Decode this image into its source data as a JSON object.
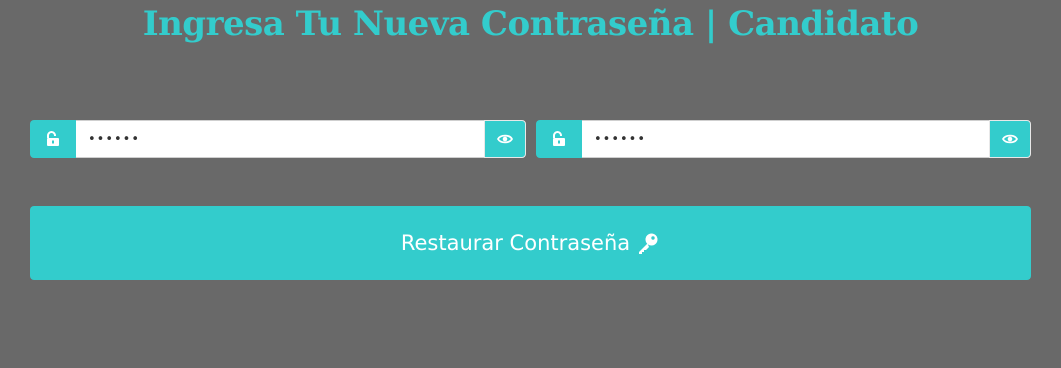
{
  "header": {
    "title": "Ingresa Tu Nueva Contraseña | Candidato"
  },
  "form": {
    "password_field": {
      "value": "••••••",
      "lock_icon": "unlock-icon",
      "toggle_icon": "eye-icon"
    },
    "confirm_password_field": {
      "value": "••••••",
      "lock_icon": "unlock-icon",
      "toggle_icon": "eye-icon"
    },
    "submit_label": "Restaurar Contraseña",
    "submit_icon": "key-icon"
  },
  "colors": {
    "background": "#696969",
    "accent": "#33cccc",
    "input_background": "#ffffff",
    "button_text": "#ffffff"
  }
}
